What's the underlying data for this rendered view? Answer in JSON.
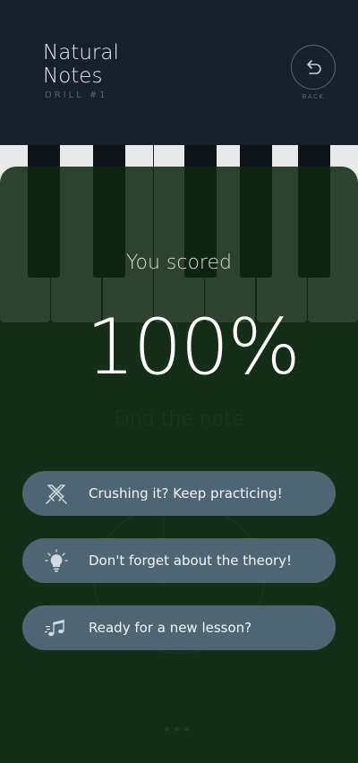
{
  "header": {
    "title_line1": "Natural",
    "title_line2": "Notes",
    "subtitle": "DRILL #1",
    "back_label": "BACK"
  },
  "background": {
    "ghost_prompt": "Find the note"
  },
  "result": {
    "label": "You scored",
    "score": "100%"
  },
  "actions": [
    {
      "label": "Crushing it? Keep practicing!",
      "icon": "crossed-swords-icon"
    },
    {
      "label": "Don't forget about the theory!",
      "icon": "lightbulb-icon"
    },
    {
      "label": "Ready for a new lesson?",
      "icon": "music-notes-icon"
    }
  ],
  "colors": {
    "header_bg": "#17202c",
    "overlay_green": "#142e17",
    "button_bg": "#4e6674",
    "text_light": "#ffffff"
  }
}
